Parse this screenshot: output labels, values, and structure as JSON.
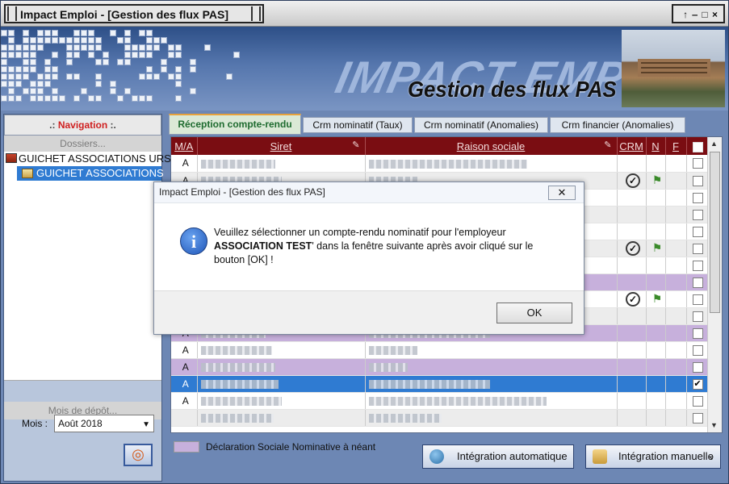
{
  "window": {
    "title": "Impact Emploi - [Gestion des flux PAS]",
    "controls": "↑ ‒ □ ×"
  },
  "banner": {
    "brand": "IMPACT EMPLOI",
    "subtitle": "Gestion des flux PAS"
  },
  "navigation": {
    "header_dots_left": ".:",
    "header_label": "Navigation",
    "header_dots_right": ":.",
    "dossiers_label": "Dossiers...",
    "tree": [
      {
        "label": "GUICHET ASSOCIATIONS URS"
      },
      {
        "label": "GUICHET ASSOCIATIONS"
      }
    ],
    "mois_depot_label": "Mois de dépôt...",
    "mois_label": "Mois :",
    "mois_value": "Août 2018"
  },
  "tabs": [
    {
      "label": "Réception compte-rendu",
      "active": true
    },
    {
      "label": "Crm nominatif (Taux)",
      "active": false
    },
    {
      "label": "Crm nominatif (Anomalies)",
      "active": false
    },
    {
      "label": "Crm financier (Anomalies)",
      "active": false
    }
  ],
  "grid": {
    "columns": [
      "M/A",
      "Siret",
      "Raison sociale",
      "CRM",
      "N",
      "F"
    ],
    "rows": [
      {
        "ma": "A",
        "style": "",
        "crm": false,
        "n": false,
        "checked": false
      },
      {
        "ma": "A",
        "style": "alt",
        "crm": true,
        "n": true,
        "checked": false
      },
      {
        "ma": "",
        "style": "",
        "crm": false,
        "n": false,
        "checked": false
      },
      {
        "ma": "",
        "style": "alt",
        "crm": false,
        "n": false,
        "checked": false
      },
      {
        "ma": "",
        "style": "",
        "crm": false,
        "n": false,
        "checked": false
      },
      {
        "ma": "",
        "style": "alt",
        "crm": true,
        "n": true,
        "checked": false
      },
      {
        "ma": "",
        "style": "",
        "crm": false,
        "n": false,
        "checked": false
      },
      {
        "ma": "",
        "style": "purple",
        "crm": false,
        "n": false,
        "checked": false
      },
      {
        "ma": "",
        "style": "",
        "crm": true,
        "n": true,
        "checked": false
      },
      {
        "ma": "",
        "style": "alt",
        "crm": false,
        "n": false,
        "checked": false
      },
      {
        "ma": "A",
        "style": "purple",
        "crm": false,
        "n": false,
        "checked": false
      },
      {
        "ma": "A",
        "style": "",
        "crm": false,
        "n": false,
        "checked": false
      },
      {
        "ma": "A",
        "style": "purple",
        "crm": false,
        "n": false,
        "checked": false
      },
      {
        "ma": "A",
        "style": "sel",
        "crm": false,
        "n": false,
        "checked": true
      },
      {
        "ma": "A",
        "style": "",
        "crm": false,
        "n": false,
        "checked": false
      },
      {
        "ma": "",
        "style": "alt",
        "crm": false,
        "n": false,
        "checked": false
      }
    ]
  },
  "legend": {
    "text": "Déclaration Sociale Nominative à néant",
    "color": "#c7b0dc"
  },
  "buttons": {
    "auto": "Intégration automatique",
    "manual": "Intégration manuelle"
  },
  "dialog": {
    "title": "Impact Emploi - [Gestion des flux PAS]",
    "line1": "Veuillez sélectionner un compte-rendu nominatif pour l'employeur",
    "employer": "ASSOCIATION TEST",
    "line2": "' dans la fenêtre suivante après avoir cliqué sur le bouton [OK] !",
    "ok": "OK"
  }
}
